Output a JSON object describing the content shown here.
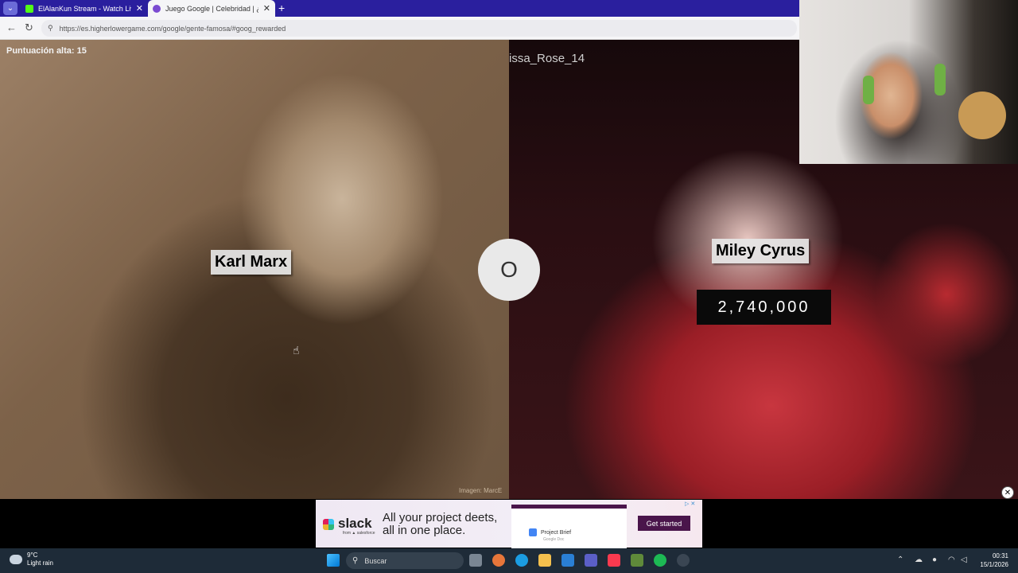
{
  "browser": {
    "tabs": [
      {
        "title": "ElAlanKun Stream - Watch Live on",
        "favicon_color": "#53fc18",
        "active": false
      },
      {
        "title": "Juego Google | Celebridad | ¿Qui",
        "favicon_color": "#7b4bd1",
        "active": true
      }
    ],
    "url": "https://es.higherlowergame.com/google/gente-famosa/#goog_rewarded"
  },
  "game": {
    "high_score": "Puntuación alta: 15",
    "left": {
      "name": "Karl Marx",
      "image_credit": "Imagen: MarcE"
    },
    "right": {
      "name": "Miley Cyrus",
      "searches": "2,740,000"
    },
    "or_label": "O"
  },
  "overlay": {
    "username": "issa_Rose_14"
  },
  "ad": {
    "brand": "slack",
    "brand_sub": "from ▲ salesforce",
    "headline": "All your project deets, all in one place.",
    "mock_card": "Project Brief",
    "mock_sub": "Google Doc",
    "cta": "Get started"
  },
  "taskbar": {
    "weather_temp": "9°C",
    "weather_desc": "Light rain",
    "search_placeholder": "Buscar",
    "time": "00:31",
    "date": "15/1/2026"
  },
  "colors": {
    "tabbar": "#2a1f9e",
    "slack_purple": "#4a154b",
    "taskbar": "#1e2b38"
  }
}
